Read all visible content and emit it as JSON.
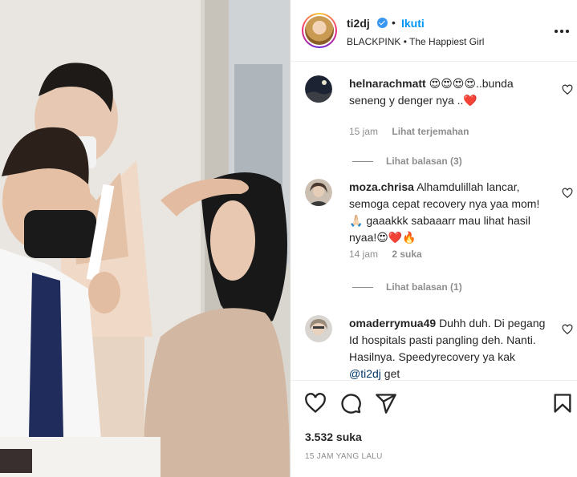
{
  "post": {
    "author": "ti2dj",
    "follow_label": "Ikuti",
    "dot": "•",
    "subline": "BLACKPINK • The Happiest Girl",
    "verified": true
  },
  "comments": [
    {
      "user": "helnarachmatt",
      "text": "😍😍😍😍..bunda seneng y denger nya ..❤️",
      "time": "15 jam",
      "translate": "Lihat terjemahan",
      "replies": "Lihat balasan (3)"
    },
    {
      "user": "moza.chrisa",
      "text": "Alhamdulillah lancar, semoga cepat recovery nya yaa mom!🙏🏻 gaaakkk sabaaarr mau lihat hasil nyaa!😍❤️🔥",
      "time": "14 jam",
      "likes": "2 suka",
      "replies": "Lihat balasan (1)"
    },
    {
      "user": "omaderrymua49",
      "text_before": "Duhh duh. Di pegang Id hospitals pasti pangling deh. Nanti. Hasilnya. Speedyrecovery ya kak ",
      "mention": "@ti2dj",
      "text_after": " get"
    }
  ],
  "actions": {
    "likes": "3.532 suka",
    "time_ago": "15 JAM YANG LALU"
  },
  "icons": [
    "verified-badge-icon",
    "more-options-icon",
    "heart-icon",
    "comment-icon",
    "share-icon",
    "bookmark-icon"
  ],
  "colors": {
    "link_blue": "#0095f6",
    "verified_blue": "#3897f0",
    "secondary_text": "#8e8e8e",
    "primary_text": "#262626",
    "divider": "#dbdbdb"
  }
}
